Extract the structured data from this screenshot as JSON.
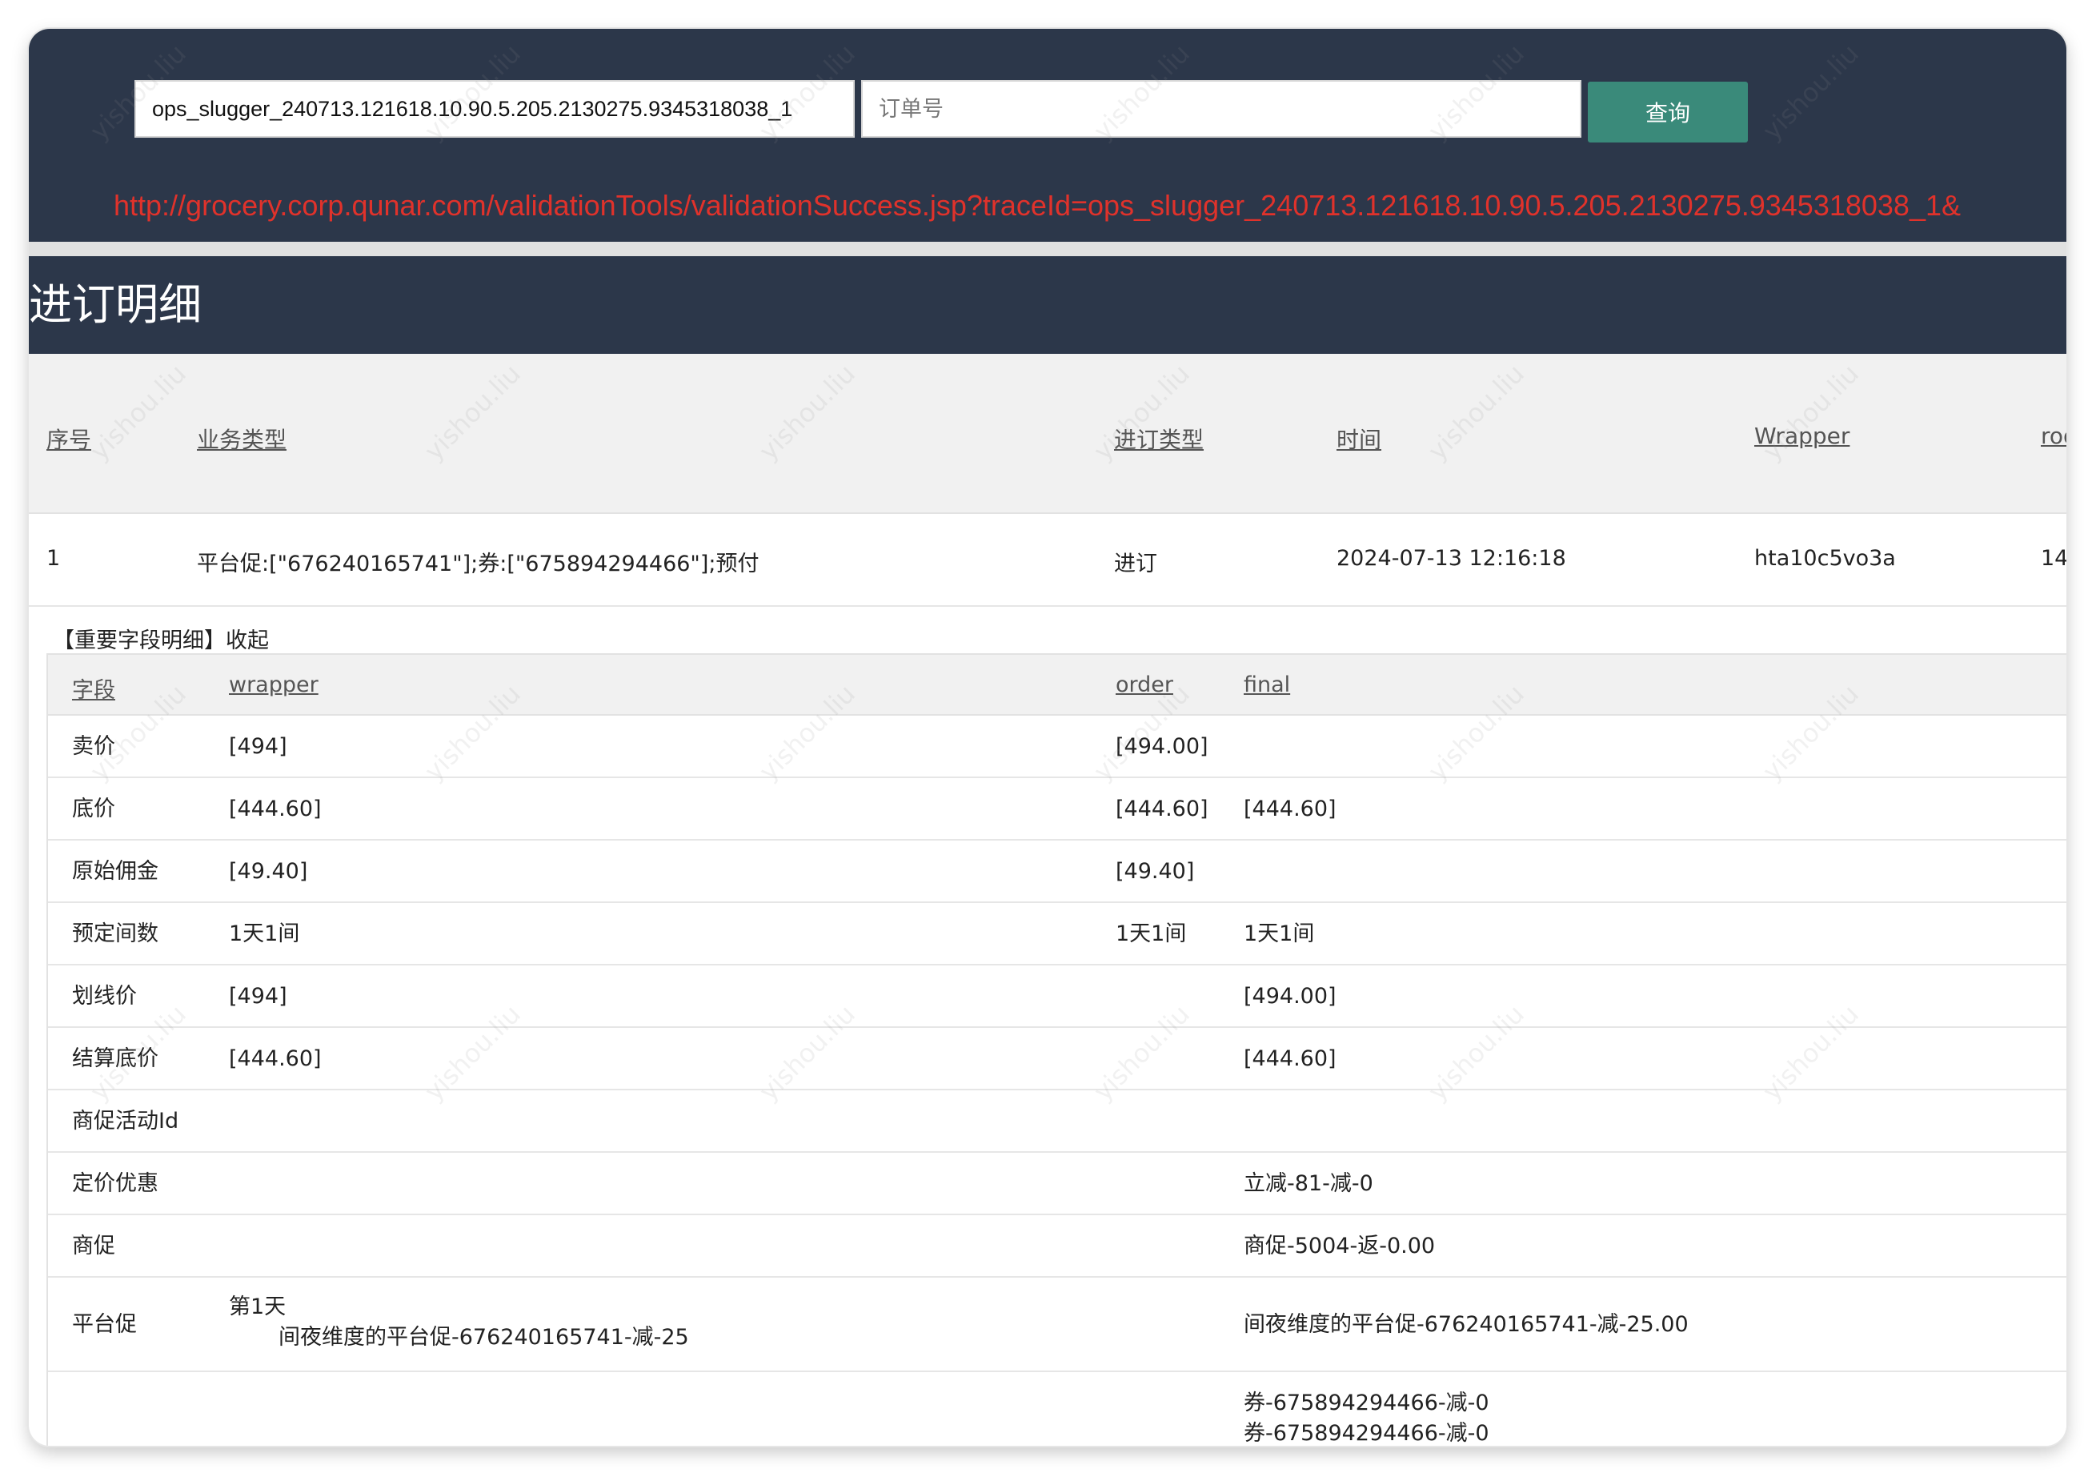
{
  "search": {
    "trace_id_value": "ops_slugger_240713.121618.10.90.5.205.2130275.9345318038_1",
    "order_placeholder": "订单号",
    "query_label": "查询"
  },
  "result_link": "http://grocery.corp.qunar.com/validationTools/validationSuccess.jsp?traceId=ops_slugger_240713.121618.10.90.5.205.2130275.9345318038_1&",
  "section_title": "进订明细",
  "main_table": {
    "headers": [
      "序号",
      "业务类型",
      "进订类型",
      "时间",
      "Wrapper",
      "roo"
    ],
    "row": {
      "index": "1",
      "business_type": "平台促:[\"676240165741\"];券:[\"675894294466\"];预付",
      "order_type": "进订",
      "time": "2024-07-13 12:16:18",
      "wrapper": "hta10c5vo3a",
      "room": "14"
    }
  },
  "detail": {
    "toggle_label": "【重要字段明细】收起",
    "headers": [
      "字段",
      "wrapper",
      "order",
      "final"
    ],
    "rows": [
      {
        "field": "卖价",
        "wrapper": "[494]",
        "order": "[494.00]",
        "final": ""
      },
      {
        "field": "底价",
        "wrapper": "[444.60]",
        "order": "[444.60]",
        "final": "[444.60]"
      },
      {
        "field": "原始佣金",
        "wrapper": "[49.40]",
        "order": "[49.40]",
        "final": ""
      },
      {
        "field": "预定间数",
        "wrapper": "1天1间",
        "order": "1天1间",
        "final": "1天1间"
      },
      {
        "field": "划线价",
        "wrapper": "[494]",
        "order": "",
        "final": "[494.00]"
      },
      {
        "field": "结算底价",
        "wrapper": "[444.60]",
        "order": "",
        "final": "[444.60]"
      },
      {
        "field": "商促活动Id",
        "wrapper": "",
        "order": "",
        "final": ""
      },
      {
        "field": "定价优惠",
        "wrapper": "",
        "order": "",
        "final": "立减-81-减-0"
      },
      {
        "field": "商促",
        "wrapper": "",
        "order": "",
        "final": "商促-5004-返-0.00"
      },
      {
        "field": "平台促",
        "wrapper_line1": "第1天",
        "wrapper_line2": "间夜维度的平台促-676240165741-减-25",
        "order": "",
        "final": "间夜维度的平台促-676240165741-减-25.00"
      },
      {
        "field": "",
        "wrapper": "",
        "order": "",
        "final_line1": "券-675894294466-减-0",
        "final_line2": "券-675894294466-减-0"
      }
    ]
  },
  "watermark_text": "yishou.liu"
}
